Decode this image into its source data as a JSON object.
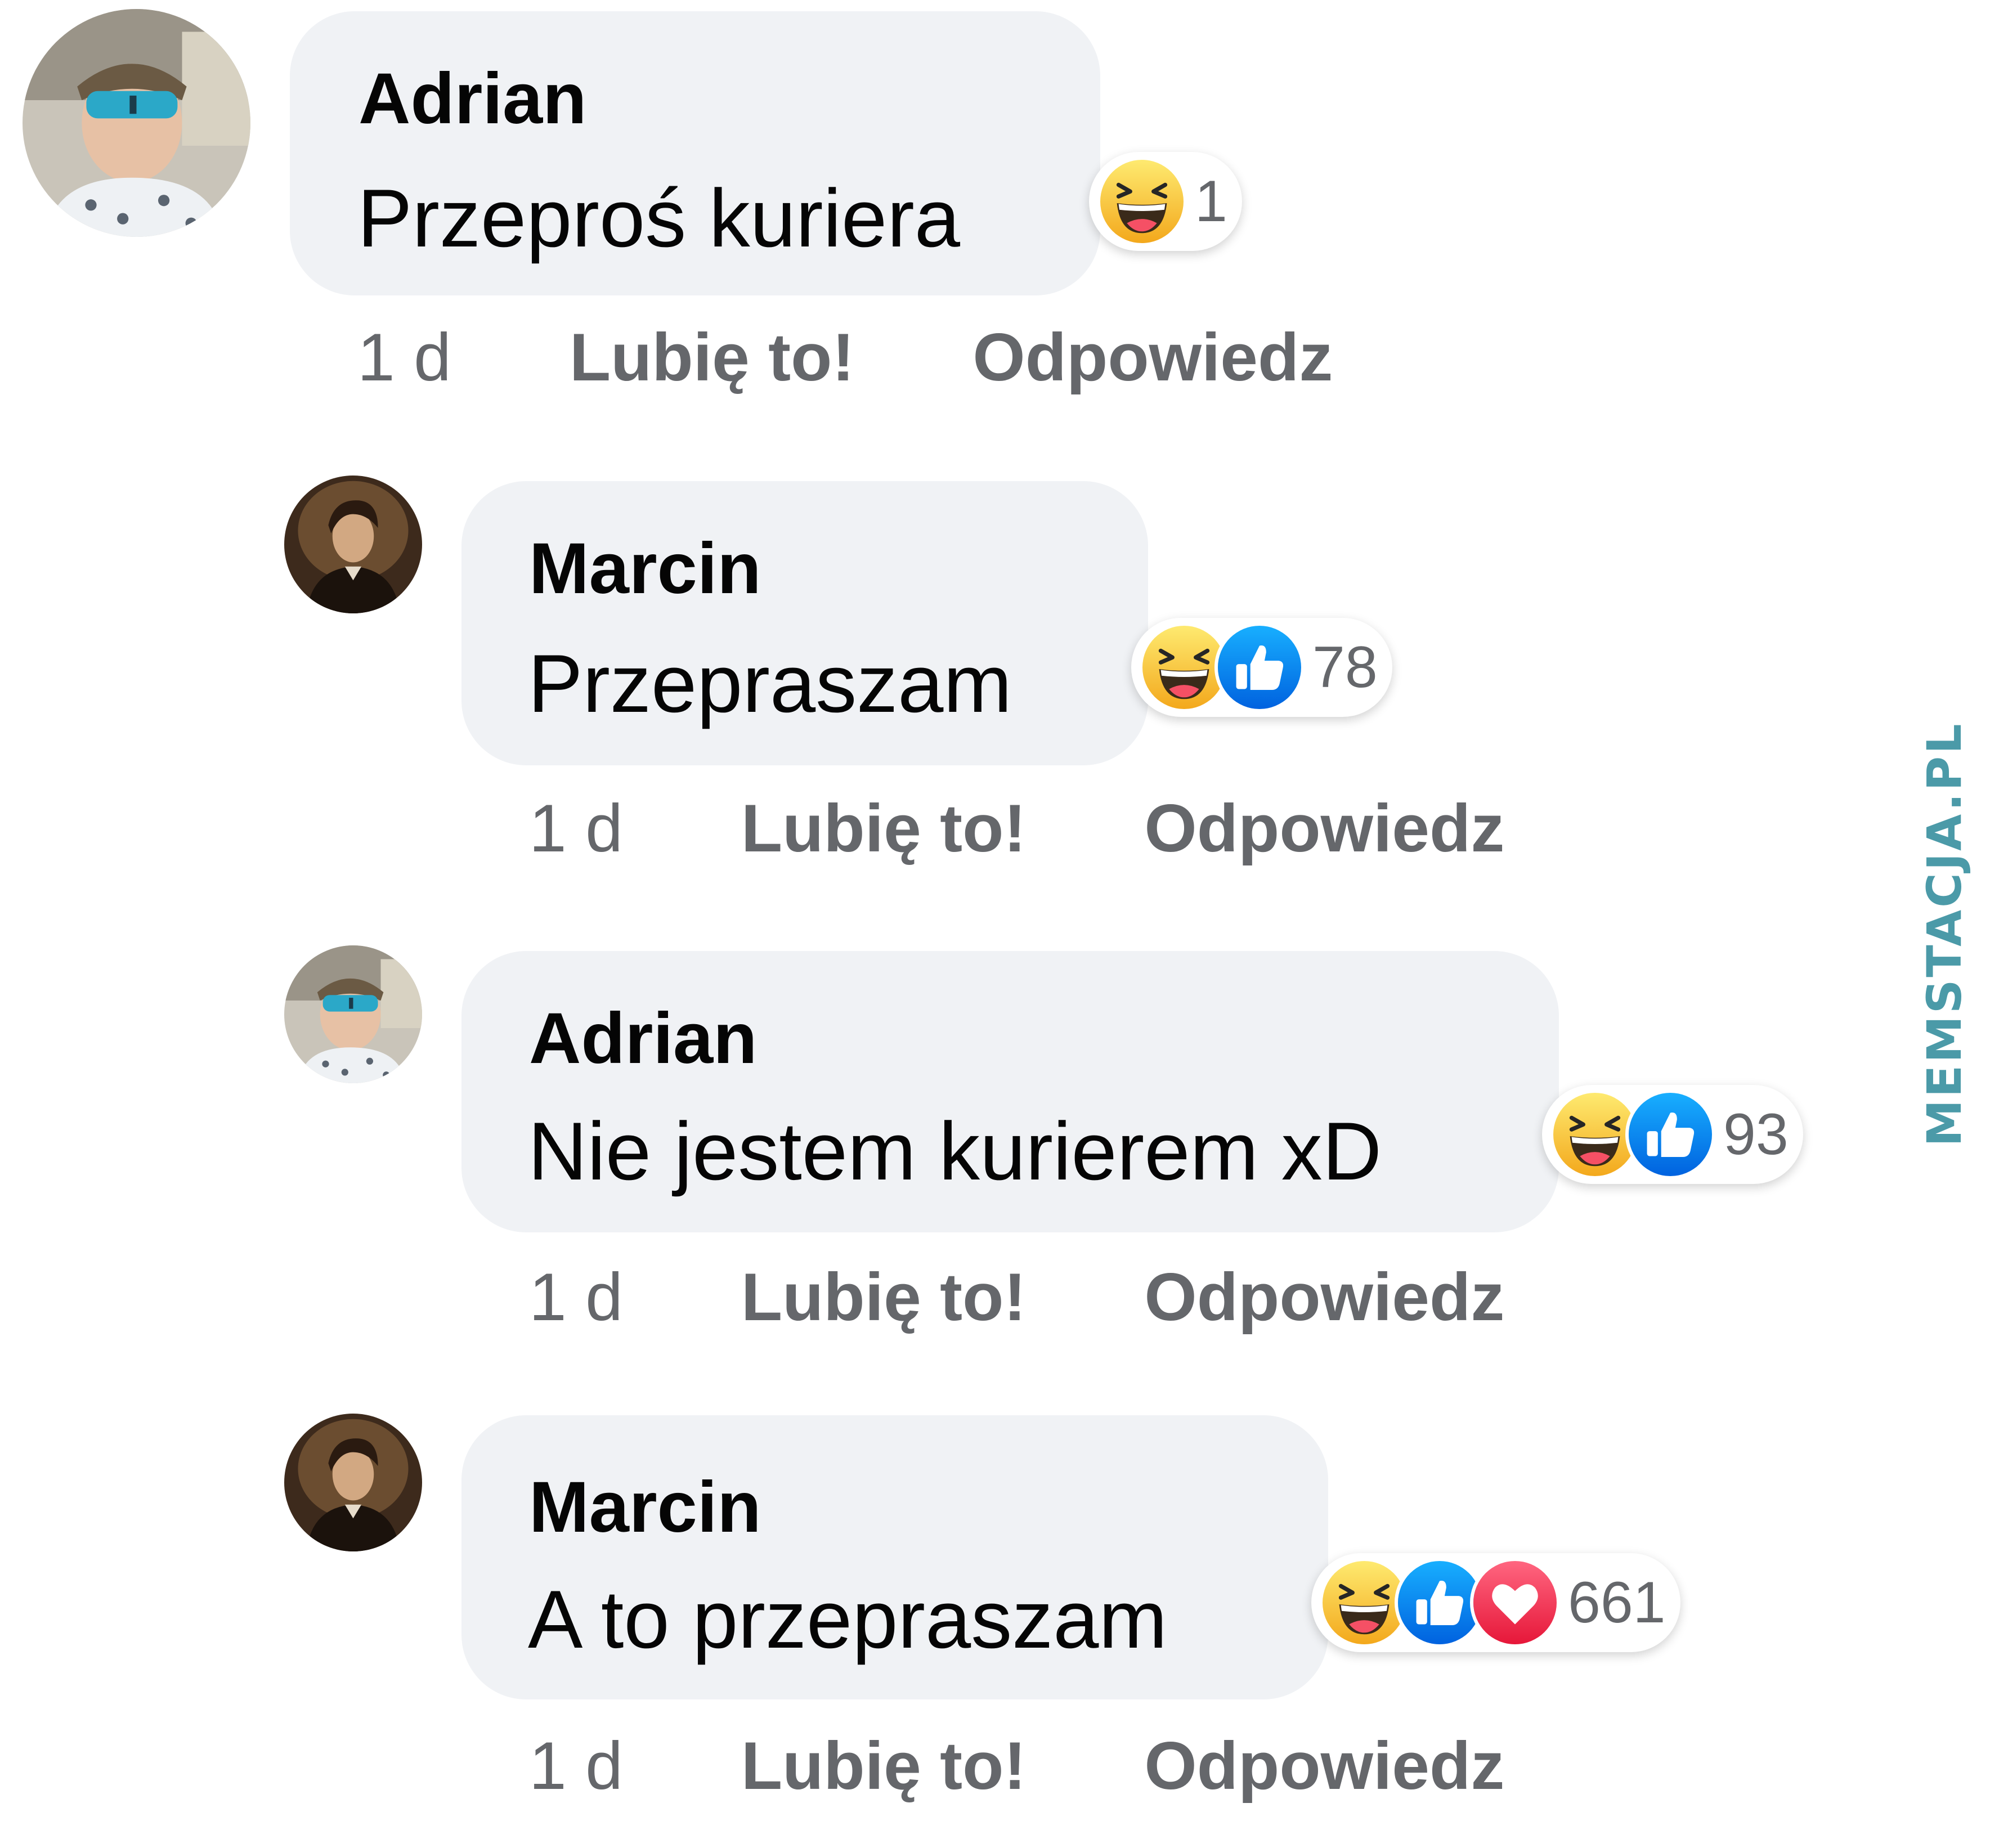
{
  "comments": [
    {
      "author": "Adrian",
      "text": "Przeproś kuriera",
      "reaction_count": "1",
      "reactions": [
        "haha-icon"
      ],
      "time": "1 d",
      "like_label": "Lubię to!",
      "reply_label": "Odpowiedz"
    },
    {
      "author": "Marcin",
      "text": "Przepraszam",
      "reaction_count": "78",
      "reactions": [
        "haha-icon",
        "like-icon"
      ],
      "time": "1 d",
      "like_label": "Lubię to!",
      "reply_label": "Odpowiedz"
    },
    {
      "author": "Adrian",
      "text": "Nie jestem kurierem xD",
      "reaction_count": "93",
      "reactions": [
        "haha-icon",
        "like-icon"
      ],
      "time": "1 d",
      "like_label": "Lubię to!",
      "reply_label": "Odpowiedz"
    },
    {
      "author": "Marcin",
      "text": "A to przepraszam",
      "reaction_count": "661",
      "reactions": [
        "haha-icon",
        "like-icon",
        "love-icon"
      ],
      "time": "1 d",
      "like_label": "Lubię to!",
      "reply_label": "Odpowiedz"
    }
  ],
  "watermark": "MEMSTACJA.PL",
  "colors": {
    "bubble": "#f0f2f5",
    "meta_text": "#65676b",
    "like_blue": "#1877f2",
    "love_red": "#f33e58",
    "haha_yellow": "#f7b928"
  }
}
